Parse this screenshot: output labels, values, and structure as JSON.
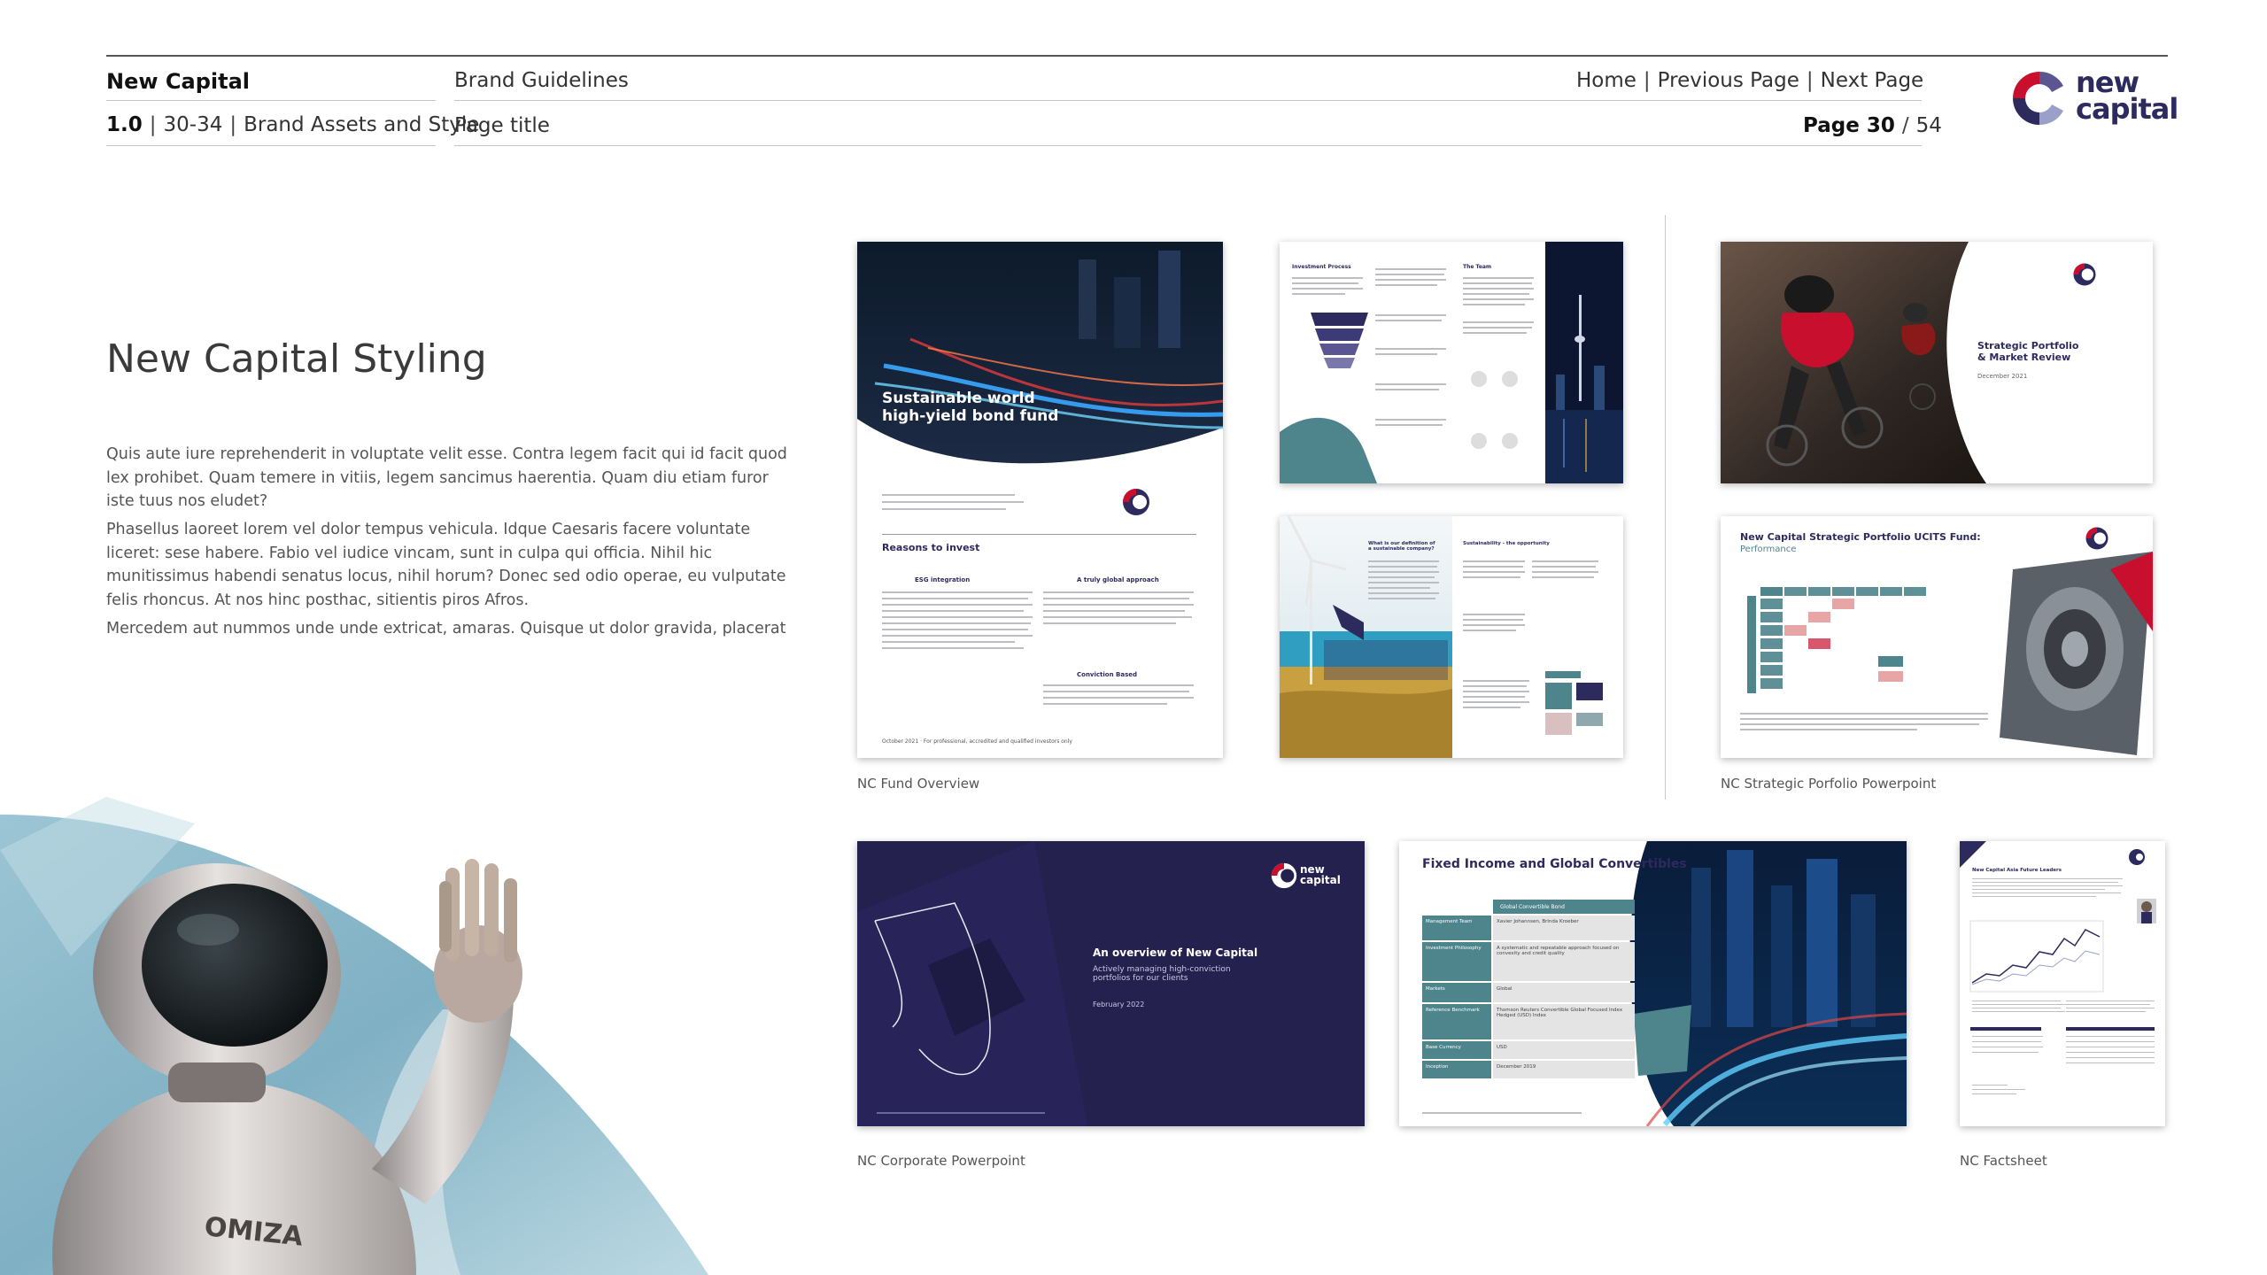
{
  "header": {
    "brand": "New Capital",
    "section": "Brand Guidelines",
    "version": "1.0",
    "pages_range": "30-34",
    "chapter": "Brand Assets and Style",
    "page_title": "Page title",
    "nav": {
      "home": "Home",
      "previous": "Previous Page",
      "next": "Next Page"
    },
    "page_label": "Page 30",
    "page_total": "54"
  },
  "logo": {
    "line1": "new",
    "line2": "capital"
  },
  "main": {
    "heading": "New Capital Styling",
    "paragraphs": [
      "Quis aute iure reprehenderit in voluptate velit esse. Contra legem facit qui id facit quod lex prohibet. Quam temere in vitiis, legem sancimus haerentia. Quam diu etiam furor iste tuus nos eludet?",
      "Phasellus laoreet lorem vel dolor tempus vehicula. Idque Caesaris facere voluntate liceret: sese habere. Fabio vel iudice vincam, sunt in culpa qui officia. Nihil hic munitissimus habendi senatus locus, nihil horum? Donec sed odio operae, eu vulputate felis rhoncus. At nos hinc posthac, sitientis piros Afros.",
      "Mercedem aut nummos unde unde extricat, amaras. Quisque ut dolor gravida, placerat"
    ]
  },
  "robot": {
    "chest_text": "OMIZA"
  },
  "thumbnails": {
    "fund_overview": {
      "caption": "NC Fund Overview",
      "title_line1": "Sustainable world",
      "title_line2": "high-yield bond fund",
      "section_title": "Reasons to invest",
      "label_esg": "ESG integration",
      "label_global": "A truly global approach",
      "label_conviction": "Conviction Based",
      "footer": "October 2021 · For professional, accredited and qualified investors only"
    },
    "investment_process": {
      "heading_left": "Investment Process",
      "heading_right": "The Team"
    },
    "sustainability": {
      "heading_left": "What is our definition of a sustainable company?",
      "heading_right": "Sustainability - the opportunity"
    },
    "strategic_portfolio": {
      "caption": "NC Strategic Porfolio Powerpoint",
      "title_line1": "Strategic Portfolio",
      "title_line2": "& Market Review",
      "date": "December 2021"
    },
    "ucits_fund": {
      "title": "New Capital Strategic Portfolio UCITS Fund:",
      "subtitle": "Performance"
    },
    "corporate": {
      "caption": "NC Corporate Powerpoint",
      "title": "An overview of New Capital",
      "subtitle_line1": "Actively managing high-conviction",
      "subtitle_line2": "portfolios for our clients",
      "date": "February 2022"
    },
    "fixed_income": {
      "title": "Fixed Income and Global Convertibles",
      "table_header": "Global Convertible Bond",
      "rows": [
        {
          "label": "Management Team",
          "value": "Xavier Johannsen, Brinda Kroeber"
        },
        {
          "label": "Investment Philosophy",
          "value": "A systematic and repeatable approach focused on convexity and credit quality"
        },
        {
          "label": "Markets",
          "value": "Global"
        },
        {
          "label": "Reference Benchmark",
          "value": "Thomson Reuters Convertible Global Focused Index Hedged (USD) Index"
        },
        {
          "label": "Base Currency",
          "value": "USD"
        },
        {
          "label": "Inception",
          "value": "December 2019"
        }
      ]
    },
    "factsheet": {
      "caption": "NC Factsheet",
      "title": "New Capital Asia Future Leaders"
    }
  },
  "colors": {
    "navy": "#2d2a5e",
    "teal": "#4e858d",
    "red": "#c8102e",
    "blue_accent": "#3f6fb5",
    "robot_backdrop": "#8fb8c8"
  }
}
